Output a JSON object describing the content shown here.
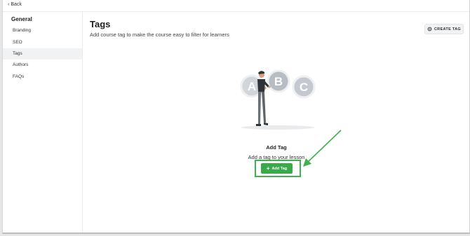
{
  "back_label": "Back",
  "sidebar": {
    "heading": "General",
    "items": [
      {
        "label": "Branding"
      },
      {
        "label": "SEO"
      },
      {
        "label": "Tags"
      },
      {
        "label": "Authors"
      },
      {
        "label": "FAQs"
      }
    ],
    "active_item": "Tags"
  },
  "header": {
    "title": "Tags",
    "subtitle": "Add course tag to make the course easy to filter for learners",
    "create_button": "CREATE TAG",
    "create_icon": "gear-icon"
  },
  "empty_state": {
    "illustration_letters": [
      "A",
      "B",
      "C"
    ],
    "title": "Add Tag",
    "subtitle": "Add a tag to your lesson",
    "button_label": "Add Tag",
    "button_icon": "plus-icon"
  },
  "colors": {
    "accent_green": "#3aa94a",
    "highlight_green": "#3fb14f",
    "circle_grey": "#c5c9cf"
  }
}
